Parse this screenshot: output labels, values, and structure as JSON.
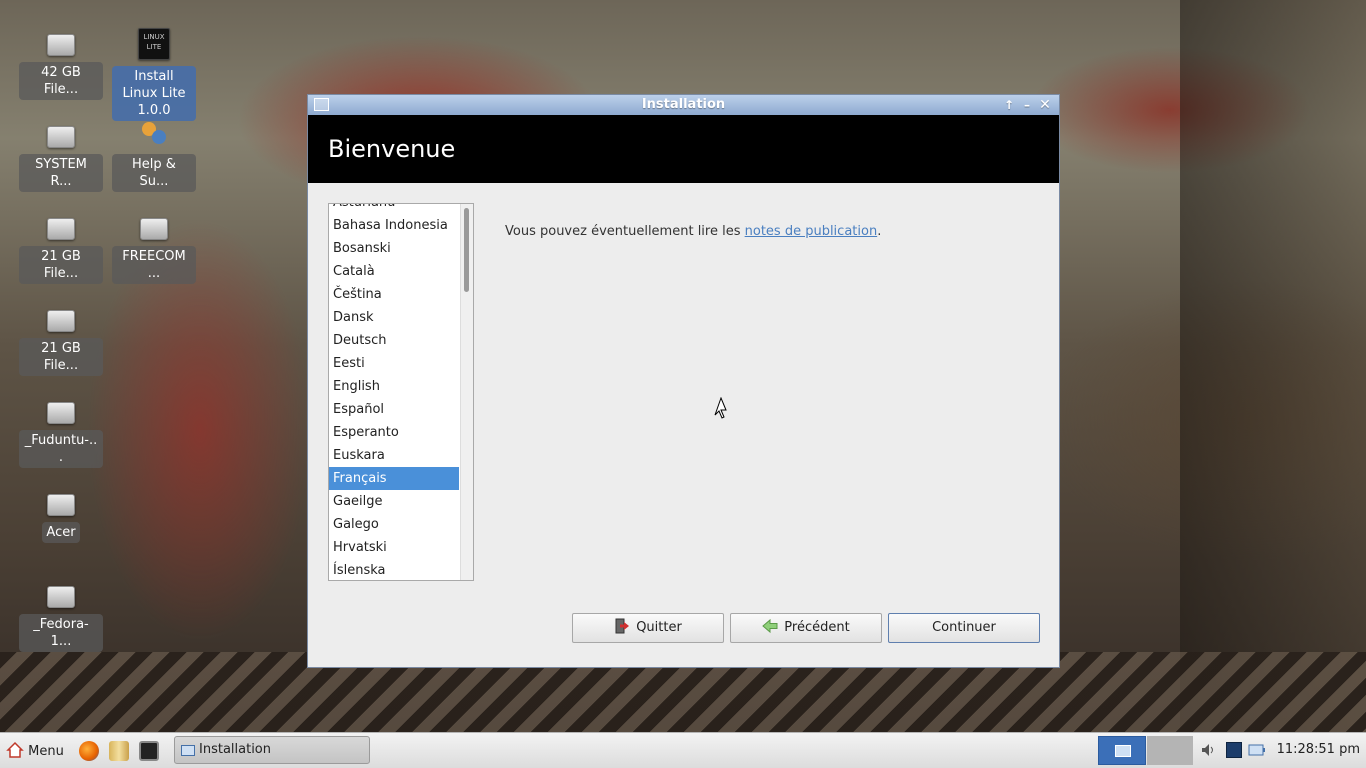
{
  "desktop": {
    "icons": [
      {
        "label": "42 GB File...",
        "icon": "drive-icon"
      },
      {
        "label": "Install Linux Lite 1.0.0",
        "icon": "linux-lite-logo-icon",
        "logo_text": "LINUX LITE"
      },
      {
        "label": "SYSTEM R...",
        "icon": "drive-icon"
      },
      {
        "label": "Help & Su...",
        "icon": "help-users-icon"
      },
      {
        "label": "21 GB File...",
        "icon": "drive-icon"
      },
      {
        "label": "FREECOM ...",
        "icon": "drive-icon"
      },
      {
        "label": "21 GB File...",
        "icon": "drive-icon"
      },
      {
        "label": "_Fuduntu-...",
        "icon": "drive-icon"
      },
      {
        "label": "Acer",
        "icon": "drive-icon"
      },
      {
        "label": "_Fedora-1...",
        "icon": "drive-icon"
      }
    ]
  },
  "window": {
    "title": "Installation",
    "header": "Bienvenue",
    "languages": [
      "Asturianu",
      "Bahasa Indonesia",
      "Bosanski",
      "Català",
      "Čeština",
      "Dansk",
      "Deutsch",
      "Eesti",
      "English",
      "Español",
      "Esperanto",
      "Euskara",
      "Français",
      "Gaeilge",
      "Galego",
      "Hrvatski",
      "Íslenska"
    ],
    "selected_language": "Français",
    "notes_prefix": "Vous pouvez éventuellement lire les ",
    "notes_link": "notes de publication",
    "notes_suffix": ".",
    "buttons": {
      "quit": "Quitter",
      "back": "Précédent",
      "continue": "Continuer"
    }
  },
  "taskbar": {
    "menu_label": "Menu",
    "task_label": "Installation",
    "clock": "11:28:51 pm"
  },
  "colors": {
    "selection": "#4a90d9",
    "titlebar": "#9fb8dc",
    "link": "#4a7fc0"
  }
}
